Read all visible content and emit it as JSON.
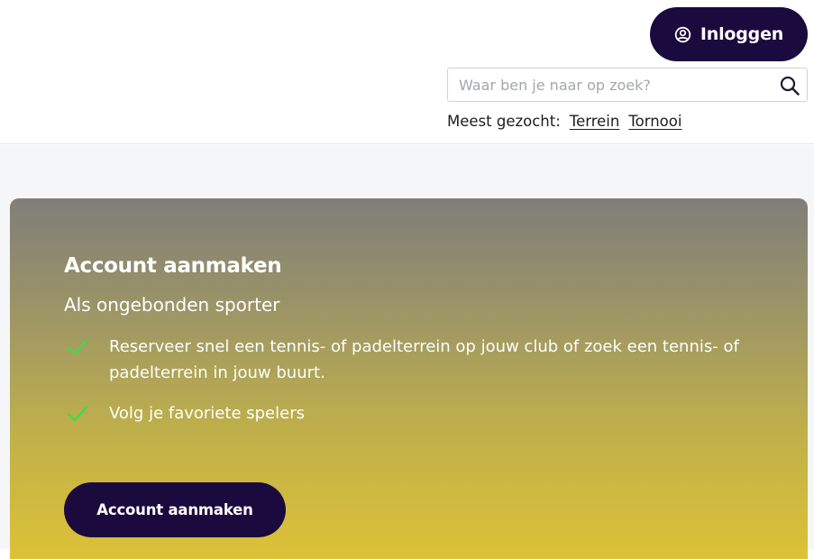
{
  "header": {
    "login_label": "Inloggen",
    "login_icon": "user-circle-icon",
    "search": {
      "placeholder": "Waar ben je naar op zoek?",
      "value": "",
      "icon": "search-icon"
    },
    "popular": {
      "label": "Meest gezocht:",
      "links": [
        "Terrein",
        "Tornooi"
      ]
    }
  },
  "signup_card": {
    "title": "Account aanmaken",
    "subtitle": "Als ongebonden sporter",
    "benefits": [
      "Reserveer snel een tennis- of padelterrein op jouw club of zoek een tennis- of padelterrein in jouw buurt.",
      "Volg je favoriete spelers"
    ],
    "check_icon": "check-icon",
    "cta_label": "Account aanmaken"
  },
  "colors": {
    "brand_dark": "#1b0a3d",
    "check_green": "#3ddc4a",
    "card_gradient_top": "#807e79",
    "card_gradient_bottom": "#dcc236",
    "band_background": "#f5f6f8"
  }
}
